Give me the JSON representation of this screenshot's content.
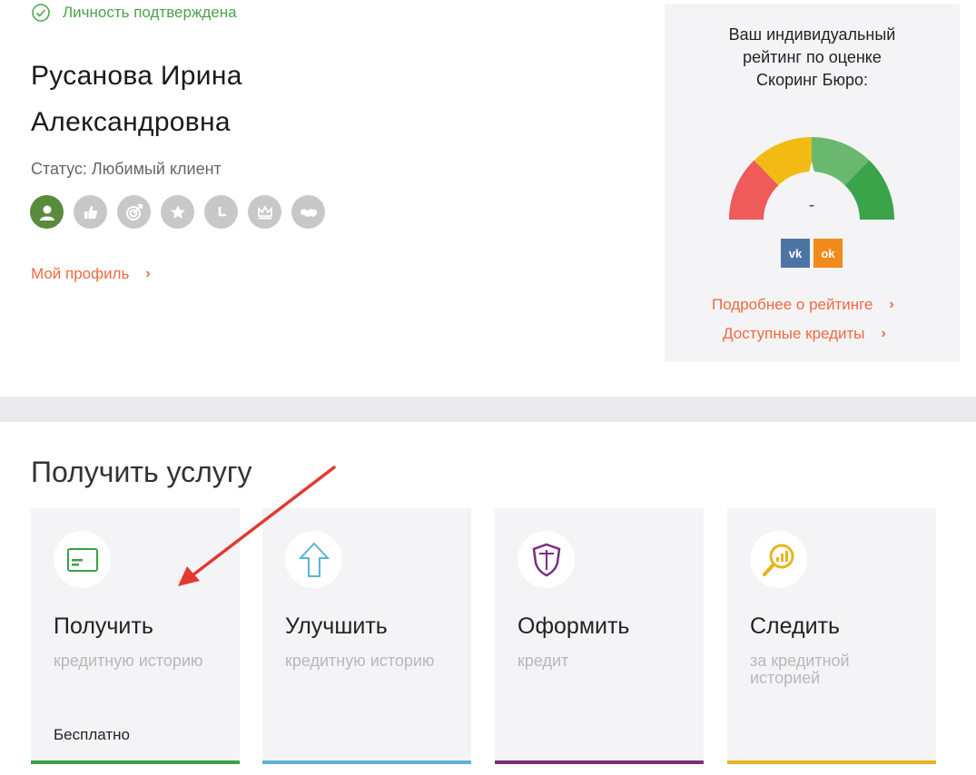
{
  "profile": {
    "verified_text": "Личность подтверждена",
    "name_line1": "Русанова Ирина",
    "name_line2": "Александровна",
    "status": "Статус: Любимый клиент",
    "badges": [
      "user-icon",
      "thumbs-up-icon",
      "target-icon",
      "star-icon",
      "clock-icon",
      "crown-icon",
      "handshake-icon"
    ],
    "profile_link": "Мой профиль"
  },
  "rating": {
    "title_line1": "Ваш индивидуальный",
    "title_line2": "рейтинг по оценке",
    "title_line3": "Скоринг Бюро:",
    "score": "-",
    "social_vk": "vk",
    "social_ok": "ok",
    "link_details": "Подробнее о рейтинге",
    "link_credits": "Доступные кредиты"
  },
  "services": {
    "title": "Получить услугу",
    "cards": [
      {
        "title": "Получить",
        "sub": "кредитную историю",
        "footer": "Бесплатно",
        "icon": "card-icon",
        "color": "#3aa04a"
      },
      {
        "title": "Улучшить",
        "sub": "кредитную историю",
        "footer": "",
        "icon": "arrow-up-icon",
        "color": "#5ab4d6"
      },
      {
        "title": "Оформить",
        "sub": "кредит",
        "footer": "",
        "icon": "shield-icon",
        "color": "#7b2c7e"
      },
      {
        "title": "Следить",
        "sub": "за кредитной историей",
        "footer": "",
        "icon": "magnifier-chart-icon",
        "color": "#e8b41c"
      }
    ]
  },
  "colors": {
    "accent_link": "#ef6a3e",
    "verified_green": "#4aa34a",
    "gauge_red": "#ef5a5a",
    "gauge_yellow": "#f2bb14",
    "gauge_lightgreen": "#6ab870",
    "gauge_green": "#3ba34a"
  }
}
